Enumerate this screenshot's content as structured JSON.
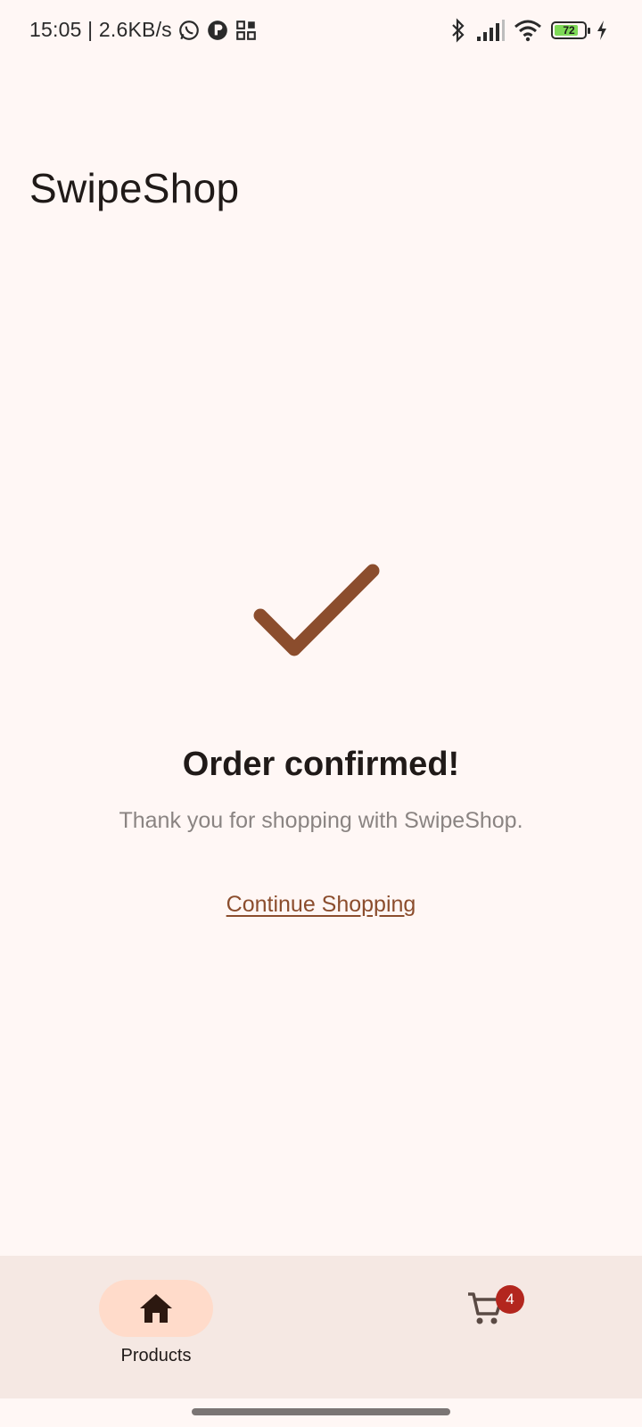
{
  "status_bar": {
    "time_speed": "15:05 | 2.6KB/s",
    "battery_level": "72",
    "icons_left": [
      "whatsapp-icon",
      "app-notification-icon",
      "grid-app-icon"
    ],
    "icons_right": [
      "bluetooth-icon",
      "signal-icon",
      "wifi-icon",
      "battery-icon",
      "charging-icon"
    ]
  },
  "app": {
    "title": "SwipeShop"
  },
  "confirmation": {
    "icon": "checkmark-icon",
    "headline": "Order confirmed!",
    "message": "Thank you for shopping with SwipeShop.",
    "continue_label": "Continue Shopping"
  },
  "bottom_nav": {
    "items": [
      {
        "label": "Products",
        "icon": "home-icon",
        "selected": true
      },
      {
        "label": "",
        "icon": "cart-icon",
        "badge": "4",
        "selected": false
      }
    ]
  },
  "colors": {
    "background": "#fff7f5",
    "accent": "#8b4d2d",
    "nav_background": "#f5e8e3",
    "nav_pill": "#ffdbca",
    "badge": "#b3261e"
  }
}
